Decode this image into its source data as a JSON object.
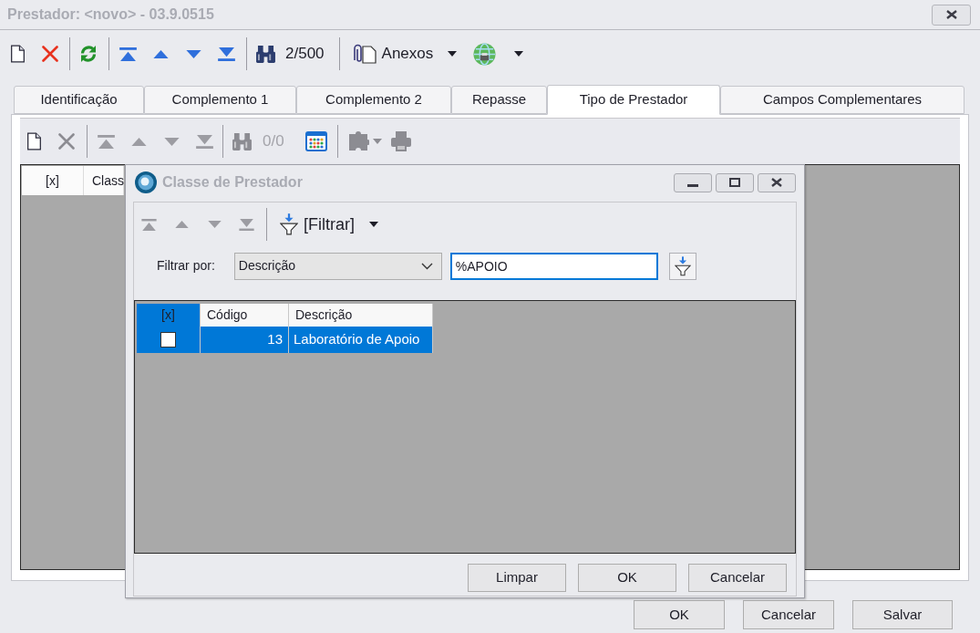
{
  "window": {
    "title": "Prestador: <novo> - 03.9.0515"
  },
  "toolbar": {
    "record_counter": "2/500",
    "attachments_label": "Anexos"
  },
  "tabs": [
    {
      "label": "Identificação",
      "selected": false
    },
    {
      "label": "Complemento 1",
      "selected": false
    },
    {
      "label": "Complemento 2",
      "selected": false
    },
    {
      "label": "Repasse",
      "selected": false
    },
    {
      "label": "Tipo de Prestador",
      "selected": true
    },
    {
      "label": "Campos Complementares",
      "selected": false
    }
  ],
  "tab_toolbar": {
    "disabled": true,
    "record_counter": "0/0"
  },
  "grid": {
    "columns": [
      "[x]",
      "Class"
    ]
  },
  "dialog": {
    "title": "Classe de Prestador",
    "toolbar": {
      "navigation_disabled": true,
      "filter_label": "[Filtrar]"
    },
    "filter": {
      "label": "Filtrar por:",
      "field": "Descrição",
      "value": "%APOIO"
    },
    "grid": {
      "columns": [
        {
          "label": "[x]",
          "selected": true
        },
        {
          "label": "Código",
          "selected": false
        },
        {
          "label": "Descrição",
          "selected": false
        }
      ],
      "rows": [
        {
          "selected": true,
          "checked": false,
          "cells": [
            "",
            "13",
            "Laboratório de Apoio"
          ]
        }
      ]
    },
    "buttons": [
      "Limpar",
      "OK",
      "Cancelar"
    ]
  },
  "buttons": [
    "OK",
    "Cancelar",
    "Salvar"
  ]
}
